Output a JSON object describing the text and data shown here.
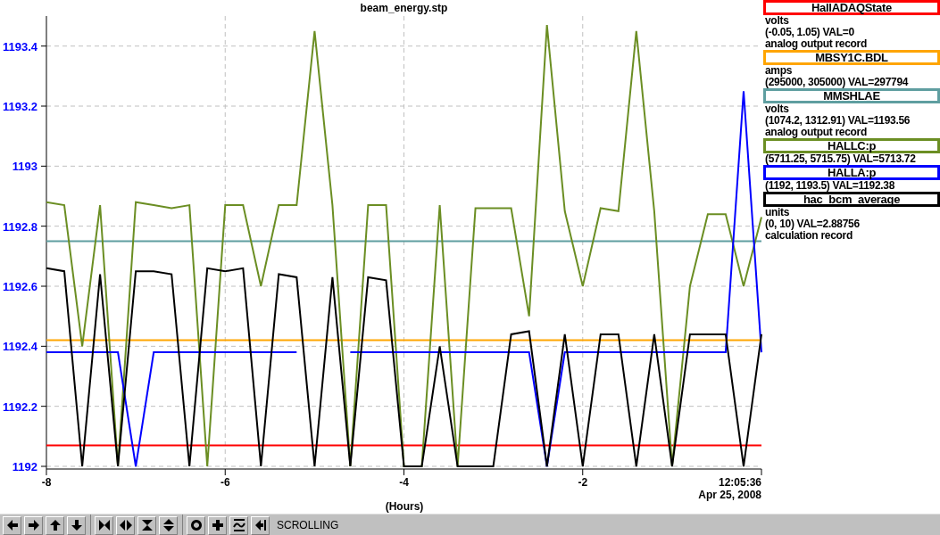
{
  "plot": {
    "timestamp": "12:05:36",
    "date": "Apr 25, 2008",
    "chart_data": {
      "type": "line",
      "title": "beam_energy.stp",
      "xlabel": "(Hours)",
      "x": [
        -8,
        -7.8,
        -7.6,
        -7.4,
        -7.2,
        -7,
        -6.8,
        -6.6,
        -6.4,
        -6.2,
        -6,
        -5.8,
        -5.6,
        -5.4,
        -5.2,
        -5,
        -4.8,
        -4.6,
        -4.4,
        -4.2,
        -4,
        -3.8,
        -3.6,
        -3.4,
        -3.2,
        -3,
        -2.8,
        -2.6,
        -2.4,
        -2.2,
        -2,
        -1.8,
        -1.6,
        -1.4,
        -1.2,
        -1,
        -0.8,
        -0.6,
        -0.4,
        -0.2,
        0
      ],
      "grid": true,
      "xlim": [
        -8,
        0
      ],
      "ylim": [
        1192,
        1193.5
      ],
      "xticks": [
        {
          "value": -8,
          "label": "-8"
        },
        {
          "value": -6,
          "label": "-6"
        },
        {
          "value": -4,
          "label": "-4"
        },
        {
          "value": -2,
          "label": "-2"
        }
      ],
      "yticks": [
        {
          "value": 1192,
          "label": "1192"
        },
        {
          "value": 1192.2,
          "label": "1192.2"
        },
        {
          "value": 1192.4,
          "label": "1192.4"
        },
        {
          "value": 1192.6,
          "label": "1192.6"
        },
        {
          "value": 1192.8,
          "label": "1192.8"
        },
        {
          "value": 1193,
          "label": "1193"
        },
        {
          "value": 1193.2,
          "label": "1193.2"
        },
        {
          "value": 1193.4,
          "label": "1193.4"
        }
      ],
      "series": [
        {
          "name": "HallADAQState",
          "color": "#ff0000",
          "values": [
            1192.07,
            1192.07,
            1192.07,
            1192.07,
            1192.07,
            1192.07,
            1192.07,
            1192.07,
            1192.07,
            1192.07,
            1192.07,
            1192.07,
            1192.07,
            1192.07,
            1192.07,
            1192.07,
            1192.07,
            1192.07,
            1192.07,
            1192.07,
            1192.07,
            1192.07,
            1192.07,
            1192.07,
            1192.07,
            1192.07,
            1192.07,
            1192.07,
            1192.07,
            1192.07,
            1192.07,
            1192.07,
            1192.07,
            1192.07,
            1192.07,
            1192.07,
            1192.07,
            1192.07,
            1192.07,
            1192.07,
            1192.07
          ]
        },
        {
          "name": "MBSY1C.BDL",
          "color": "#ffa500",
          "values": [
            1192.42,
            1192.42,
            1192.42,
            1192.42,
            1192.42,
            1192.42,
            1192.42,
            1192.42,
            1192.42,
            1192.42,
            1192.42,
            1192.42,
            1192.42,
            1192.42,
            1192.42,
            1192.42,
            1192.42,
            1192.42,
            1192.42,
            1192.42,
            1192.42,
            1192.42,
            1192.42,
            1192.42,
            1192.42,
            1192.42,
            1192.42,
            1192.42,
            1192.42,
            1192.42,
            1192.42,
            1192.42,
            1192.42,
            1192.42,
            1192.42,
            1192.42,
            1192.42,
            1192.42,
            1192.42,
            1192.42,
            1192.42
          ]
        },
        {
          "name": "MMSHLAE",
          "color": "#5f9ea0",
          "values": [
            1192.75,
            1192.75,
            1192.75,
            1192.75,
            1192.75,
            1192.75,
            1192.75,
            1192.75,
            1192.75,
            1192.75,
            1192.75,
            1192.75,
            1192.75,
            1192.75,
            1192.75,
            1192.75,
            1192.75,
            1192.75,
            1192.75,
            1192.75,
            1192.75,
            1192.75,
            1192.75,
            1192.75,
            1192.75,
            1192.75,
            1192.75,
            1192.75,
            1192.75,
            1192.75,
            1192.75,
            1192.75,
            1192.75,
            1192.75,
            1192.75,
            1192.75,
            1192.75,
            1192.75,
            1192.75,
            1192.75,
            1192.75
          ]
        },
        {
          "name": "HALLC:p",
          "color": "#6b8e23",
          "values": [
            1192.88,
            1192.87,
            1192.4,
            1192.87,
            1192.0,
            1192.88,
            1192.87,
            1192.86,
            1192.87,
            1192.0,
            1192.87,
            1192.87,
            1192.6,
            1192.87,
            1192.87,
            1193.45,
            1192.87,
            1192.0,
            1192.87,
            1192.87,
            1192.0,
            1192.0,
            1192.87,
            1192.0,
            1192.86,
            1192.86,
            1192.86,
            1192.5,
            1193.47,
            1192.85,
            1192.6,
            1192.86,
            1192.85,
            1193.45,
            1192.85,
            1192.0,
            1192.6,
            1192.84,
            1192.84,
            1192.6,
            1192.83
          ]
        },
        {
          "name": "HALLA:p",
          "color": "#0000ff",
          "values": [
            1192.38,
            1192.38,
            1192.38,
            1192.38,
            1192.38,
            1192.0,
            1192.38,
            1192.38,
            1192.38,
            1192.38,
            1192.38,
            1192.38,
            1192.38,
            1192.38,
            1192.38,
            null,
            null,
            1192.38,
            1192.38,
            1192.38,
            1192.38,
            1192.38,
            1192.38,
            1192.38,
            1192.38,
            1192.38,
            1192.38,
            1192.38,
            1192.0,
            1192.38,
            1192.38,
            1192.38,
            1192.38,
            1192.38,
            1192.38,
            1192.38,
            1192.38,
            1192.38,
            1192.38,
            1193.25,
            1192.38
          ]
        },
        {
          "name": "hac_bcm_average",
          "color": "#000000",
          "values": [
            1192.66,
            1192.65,
            1192.0,
            1192.64,
            1192.0,
            1192.65,
            1192.65,
            1192.64,
            1192.0,
            1192.66,
            1192.65,
            1192.66,
            1192.0,
            1192.64,
            1192.63,
            1192.0,
            1192.63,
            1192.0,
            1192.63,
            1192.62,
            1192.0,
            1192.0,
            1192.4,
            1192.0,
            1192.0,
            1192.0,
            1192.44,
            1192.45,
            1192.0,
            1192.44,
            1192.0,
            1192.44,
            1192.44,
            1192.0,
            1192.44,
            1192.0,
            1192.44,
            1192.44,
            1192.44,
            1192.0,
            1192.44
          ]
        }
      ]
    }
  },
  "legend": [
    {
      "lines": [
        "volts",
        "(-0.05, 1.05) VAL=0",
        "analog output record"
      ]
    },
    {
      "lines": [
        "amps",
        "(295000, 305000) VAL=297794"
      ]
    },
    {
      "lines": [
        "volts",
        "(1074.2, 1312.91) VAL=1193.56",
        "analog output record"
      ]
    },
    {
      "lines": [
        "(5711.25, 5715.75) VAL=5713.72"
      ]
    },
    {
      "lines": [
        "(1192, 1193.5) VAL=1192.38"
      ]
    },
    {
      "lines": [
        "units",
        "(0, 10) VAL=2.88756",
        "calculation record"
      ]
    }
  ],
  "toolbar": {
    "status": "SCROLLING"
  }
}
